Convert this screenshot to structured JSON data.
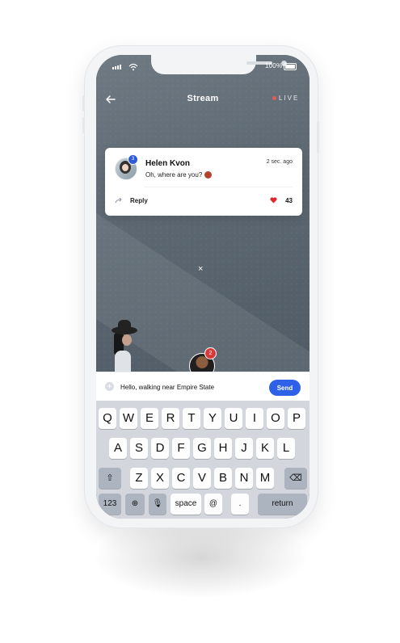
{
  "status_bar": {
    "battery_percent": "100%",
    "signal_icon": "signal-icon",
    "wifi_icon": "wifi-icon",
    "battery_icon": "battery-icon"
  },
  "header": {
    "title": "Stream",
    "live_label": "LIVE",
    "back_icon": "back-arrow-icon"
  },
  "comment_card": {
    "name": "Helen Kvon",
    "time": "2 sec. ago",
    "message": "Oh, where are you?",
    "badge": "3",
    "reply_label": "Reply",
    "likes": "43",
    "reply_icon": "reply-icon",
    "heart_icon": "heart-icon"
  },
  "overlay": {
    "close_icon": "close-icon",
    "close_symbol": "×",
    "viewer_badge": "2"
  },
  "composer": {
    "input_value": "Hello, walking near Empire State",
    "send_label": "Send",
    "add_icon": "plus-icon",
    "add_symbol": "+"
  },
  "keyboard": {
    "row1": [
      "Q",
      "W",
      "E",
      "R",
      "T",
      "Y",
      "U",
      "I",
      "O",
      "P"
    ],
    "row2": [
      "A",
      "S",
      "D",
      "F",
      "G",
      "H",
      "J",
      "K",
      "L"
    ],
    "row3": [
      "⇧",
      "Z",
      "X",
      "C",
      "V",
      "B",
      "N",
      "M",
      "⌫"
    ],
    "row4": [
      "123",
      "⊕",
      "🎙",
      "space",
      "@",
      ".",
      "return"
    ]
  }
}
